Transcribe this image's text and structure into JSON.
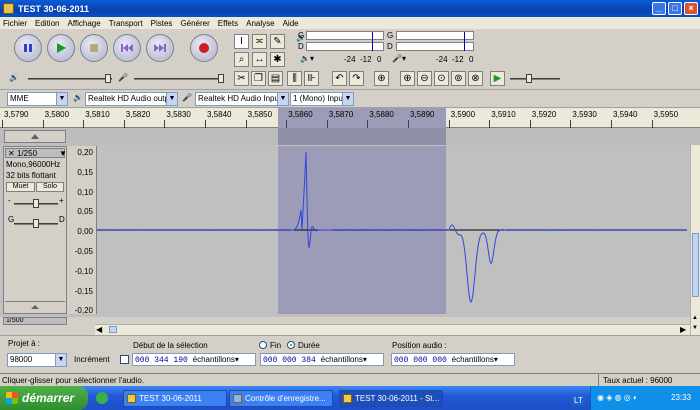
{
  "window": {
    "title": "TEST 30-06-2011"
  },
  "menu": [
    "Fichier",
    "Edition",
    "Affichage",
    "Transport",
    "Pistes",
    "Générer",
    "Effets",
    "Analyse",
    "Aide"
  ],
  "meters": {
    "left_letter": "G",
    "right_letter": "D",
    "play_scale": [
      "-24",
      "-12",
      "0"
    ],
    "rec_scale": [
      "-24",
      "-12",
      "0"
    ]
  },
  "devices": {
    "host": "MME",
    "output": "Realtek HD Audio outpu",
    "input": "Realtek HD Audio Input",
    "channels": "1 (Mono) Inpu"
  },
  "ruler_labels": [
    "3,5790",
    "3,5800",
    "3,5810",
    "3,5820",
    "3,5830",
    "3,5840",
    "3,5850",
    "3,5860",
    "3,5870",
    "3,5880",
    "3,5890",
    "3,5900",
    "3,5910",
    "3,5920",
    "3,5930",
    "3,5940",
    "3,5950"
  ],
  "track": {
    "name": "1/250",
    "format": "Mono,96000Hz",
    "bits": "32 bits flottant",
    "mute": "Muet",
    "solo": "Solo",
    "pan_left": "G",
    "pan_right": "D",
    "next_name": "1/500"
  },
  "amplitude_ticks": [
    "0,20",
    "0,15",
    "0,10",
    "0,05",
    "0,00",
    "-0,05",
    "-0,10",
    "-0,15",
    "-0,20"
  ],
  "selection_bar": {
    "project_rate_label": "Projet à :",
    "project_rate": "98000",
    "snap_label": "Incrément",
    "sel_start_label": "Début de la sélection",
    "end_label": "Fin",
    "length_label": "Durée",
    "audio_pos_label": "Position audio :",
    "sel_start": "000 344 190",
    "length": "000 000 384",
    "audio_pos": "000 000 000",
    "unit": "échantillons"
  },
  "status": {
    "hint": "Cliquer-glisser pour sélectionner l'audio.",
    "rate": "Taux actuel : 96000"
  },
  "taskbar": {
    "start": "démarrer",
    "tasks": [
      "TEST 30-06-2011",
      "Contrôle d'enregistre...",
      "TEST 30-06-2011 - St..."
    ],
    "lang": "LT",
    "clock": "23:33"
  }
}
